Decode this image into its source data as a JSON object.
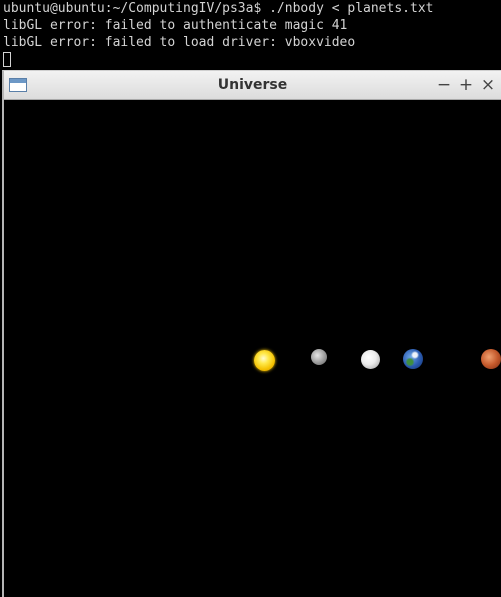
{
  "terminal": {
    "lines": [
      "ubuntu@ubuntu:~/ComputingIV/ps3a$ ./nbody < planets.txt",
      "libGL error: failed to authenticate magic 41",
      "libGL error: failed to load driver: vboxvideo"
    ]
  },
  "window": {
    "title": "Universe",
    "controls": {
      "minimize": "−",
      "maximize": "+",
      "close": "×"
    }
  },
  "planets": [
    {
      "name": "sun",
      "color": "#f4c000"
    },
    {
      "name": "mercury",
      "color": "#a8a8a8"
    },
    {
      "name": "venus",
      "color": "#ececec"
    },
    {
      "name": "earth",
      "color": "#2a5ab0"
    },
    {
      "name": "mars",
      "color": "#c55a2c"
    }
  ]
}
